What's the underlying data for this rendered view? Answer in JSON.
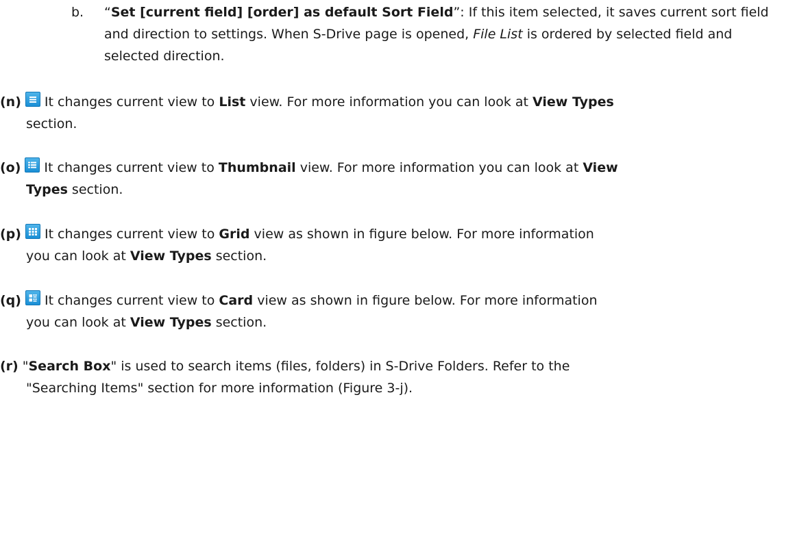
{
  "sub_b": {
    "marker": "b.",
    "quote_open": "“",
    "title": "Set [current field] [order] as default Sort Field",
    "quote_close": "”",
    "text_1": ": If this item selected, it saves current sort field and direction to settings. When S-Drive page is opened, ",
    "file_list": "File List",
    "text_2": " is ordered by selected field and selected direction."
  },
  "items": [
    {
      "marker": "(n)",
      "icon": "list-view-icon",
      "text_1": "It changes current view to ",
      "view": "List",
      "text_2": " view. For more information you can look at ",
      "ref": "View Types",
      "text_3": " section."
    },
    {
      "marker": "(o)",
      "icon": "thumbnail-view-icon",
      "text_1": "It changes current view to ",
      "view": "Thumbnail",
      "text_2": " view. For more information you can look at ",
      "ref": "View Types",
      "text_3": " section."
    },
    {
      "marker": "(p)",
      "icon": "grid-view-icon",
      "text_1": "It changes current view to ",
      "view": "Grid",
      "text_2": " view as shown in figure below. For more information you can look at ",
      "ref": "View Types",
      "text_3": " section."
    },
    {
      "marker": "(q)",
      "icon": "card-view-icon",
      "text_1": "It changes current view to ",
      "view": "Card",
      "text_2": " view as shown in figure below. For more information you can look at ",
      "ref": "View Types",
      "text_3": " section."
    },
    {
      "marker": "(r)",
      "quote_open": "\"",
      "title": "Search Box",
      "quote_close": "\"",
      "text_1": " is used to search items (files, folders) in S-Drive Folders. Refer to the \"Searching Items\" section for more information (Figure 3-j)."
    }
  ],
  "colors": {
    "text": "#1a1a1a",
    "icon_blue": "#1a8fd6"
  }
}
